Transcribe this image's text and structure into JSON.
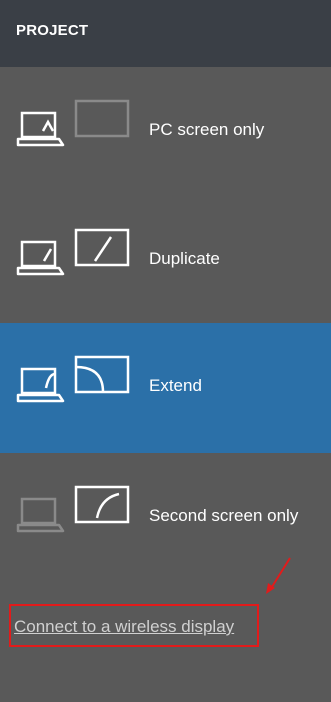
{
  "header": {
    "title": "PROJECT"
  },
  "options": [
    {
      "label": "PC screen only",
      "icon": "pc-screen-only-icon",
      "selected": false
    },
    {
      "label": "Duplicate",
      "icon": "duplicate-icon",
      "selected": false
    },
    {
      "label": "Extend",
      "icon": "extend-icon",
      "selected": true
    },
    {
      "label": "Second screen only",
      "icon": "second-screen-only-icon",
      "selected": false
    }
  ],
  "wireless_link": {
    "label": "Connect to a wireless display"
  },
  "colors": {
    "header_bg": "#3a3f46",
    "panel_bg": "#595959",
    "selected_bg": "#2b70a8",
    "annotation_red": "#e21b1b",
    "dim_icon": "#8a8a8a"
  }
}
